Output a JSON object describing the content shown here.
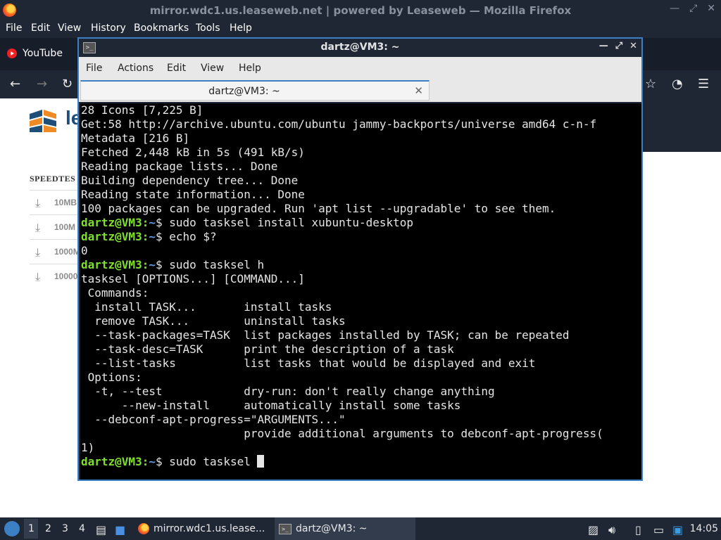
{
  "firefox": {
    "title": "mirror.wdc1.us.leaseweb.net | powered by Leaseweb — Mozilla Firefox",
    "menu": [
      "File",
      "Edit",
      "View",
      "History",
      "Bookmarks",
      "Tools",
      "Help"
    ],
    "tab_label": "YouTube",
    "page": {
      "logo_text": "le",
      "speedtest_title": "SPEEDTES",
      "downloads": [
        "10MB",
        "100M",
        "1000M",
        "10000"
      ]
    }
  },
  "terminal": {
    "title": "dartz@VM3: ~",
    "menu": [
      "File",
      "Actions",
      "Edit",
      "View",
      "Help"
    ],
    "tab_label": "dartz@VM3: ~",
    "lines": [
      {
        "text": "28 Icons [7,225 B]"
      },
      {
        "text": "Get:58 http://archive.ubuntu.com/ubuntu jammy-backports/universe amd64 c-n-f"
      },
      {
        "text": "Metadata [216 B]"
      },
      {
        "text": "Fetched 2,448 kB in 5s (491 kB/s)"
      },
      {
        "text": "Reading package lists... Done"
      },
      {
        "text": "Building dependency tree... Done"
      },
      {
        "text": "Reading state information... Done"
      },
      {
        "text": "100 packages can be upgraded. Run 'apt list --upgradable' to see them."
      },
      {
        "prompt_user": "dartz@VM3",
        "prompt_path": "~",
        "cmd": "$ sudo tasksel install xubuntu-desktop"
      },
      {
        "prompt_user": "dartz@VM3",
        "prompt_path": "~",
        "cmd": "$ echo $?"
      },
      {
        "text": "0"
      },
      {
        "prompt_user": "dartz@VM3",
        "prompt_path": "~",
        "cmd": "$ sudo tasksel h"
      },
      {
        "text": "tasksel [OPTIONS...] [COMMAND...]"
      },
      {
        "text": " Commands:"
      },
      {
        "text": "  install TASK...       install tasks"
      },
      {
        "text": "  remove TASK...        uninstall tasks"
      },
      {
        "text": "  --task-packages=TASK  list packages installed by TASK; can be repeated"
      },
      {
        "text": "  --task-desc=TASK      print the description of a task"
      },
      {
        "text": "  --list-tasks          list tasks that would be displayed and exit"
      },
      {
        "text": " Options:"
      },
      {
        "text": "  -t, --test            dry-run: don't really change anything"
      },
      {
        "text": "      --new-install     automatically install some tasks"
      },
      {
        "text": "  --debconf-apt-progress=\"ARGUMENTS...\""
      },
      {
        "text": "                        provide additional arguments to debconf-apt-progress("
      },
      {
        "text": "1)"
      },
      {
        "prompt_user": "dartz@VM3",
        "prompt_path": "~",
        "cmd": "$ sudo tasksel ",
        "cursor": true
      }
    ]
  },
  "taskbar": {
    "workspaces": [
      "1",
      "2",
      "3",
      "4"
    ],
    "tasks": [
      {
        "label": "mirror.wdc1.us.lease..."
      },
      {
        "label": "dartz@VM3: ~"
      }
    ],
    "clock": "14:05"
  }
}
